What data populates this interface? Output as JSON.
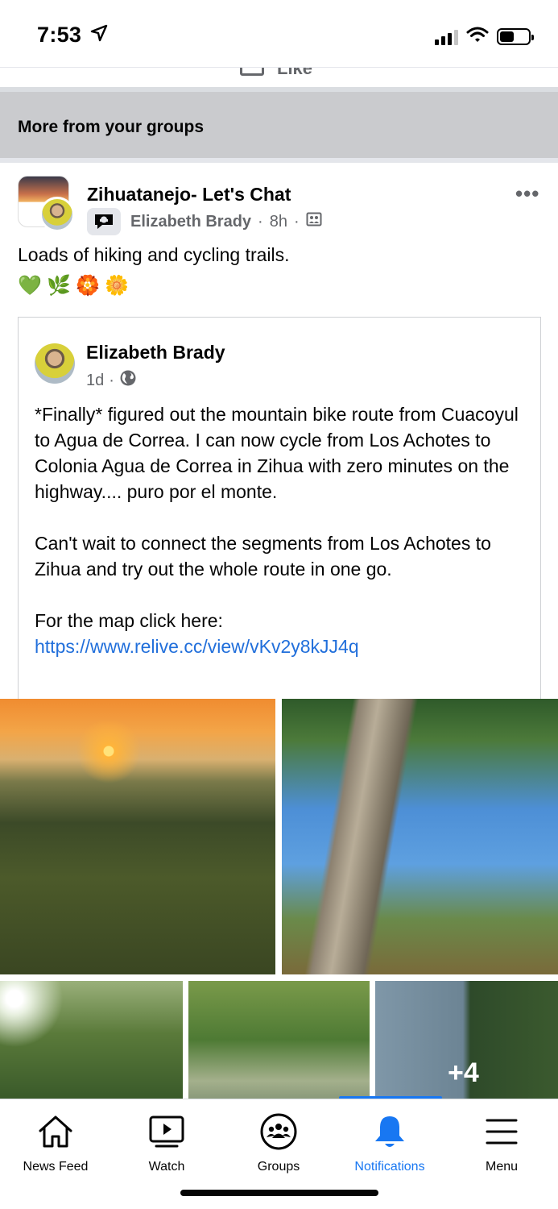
{
  "status_bar": {
    "time": "7:53",
    "icons": [
      "location-arrow-icon",
      "signal-icon",
      "wifi-icon",
      "battery-icon"
    ],
    "battery_level": 0.5
  },
  "previous_post": {
    "like_label": "Like"
  },
  "section": {
    "title": "More from your groups"
  },
  "post": {
    "group_name": "Zihuatanejo- Let's Chat",
    "author": "Elizabeth Brady",
    "time": "8h",
    "separator": "·",
    "text": "Loads of hiking and cycling trails.",
    "emojis": [
      "💚",
      "🌿",
      "🏵️",
      "🌼"
    ],
    "more_label": "•••"
  },
  "shared_post": {
    "author": "Elizabeth Brady",
    "time": "1d",
    "separator": "·",
    "paragraph_1": "*Finally* figured out the mountain bike route from Cuacoyul to Agua de Correa.  I can now cycle from Los Achotes to Colonia Agua de Correa in Zihua with zero minutes on the highway.... puro por el monte.",
    "paragraph_2": "Can't wait to connect the segments from Los Achotes to Zihua and try out the whole route in one go.",
    "map_prefix": "For the map click here: ",
    "map_link": "https://www.relive.cc/view/vKv2y8kJJ4q"
  },
  "photos": {
    "more_count": "+4"
  },
  "tab_bar": {
    "items": [
      {
        "label": "News Feed",
        "icon": "home-icon"
      },
      {
        "label": "Watch",
        "icon": "watch-play-icon"
      },
      {
        "label": "Groups",
        "icon": "groups-icon"
      },
      {
        "label": "Notifications",
        "icon": "bell-icon"
      },
      {
        "label": "Menu",
        "icon": "hamburger-menu-icon"
      }
    ],
    "active": "Notifications",
    "accent": "#1877f2"
  },
  "colors": {
    "link": "#216fdb",
    "secondary_text": "#65676b",
    "section_header_bg": "#cacbce"
  }
}
